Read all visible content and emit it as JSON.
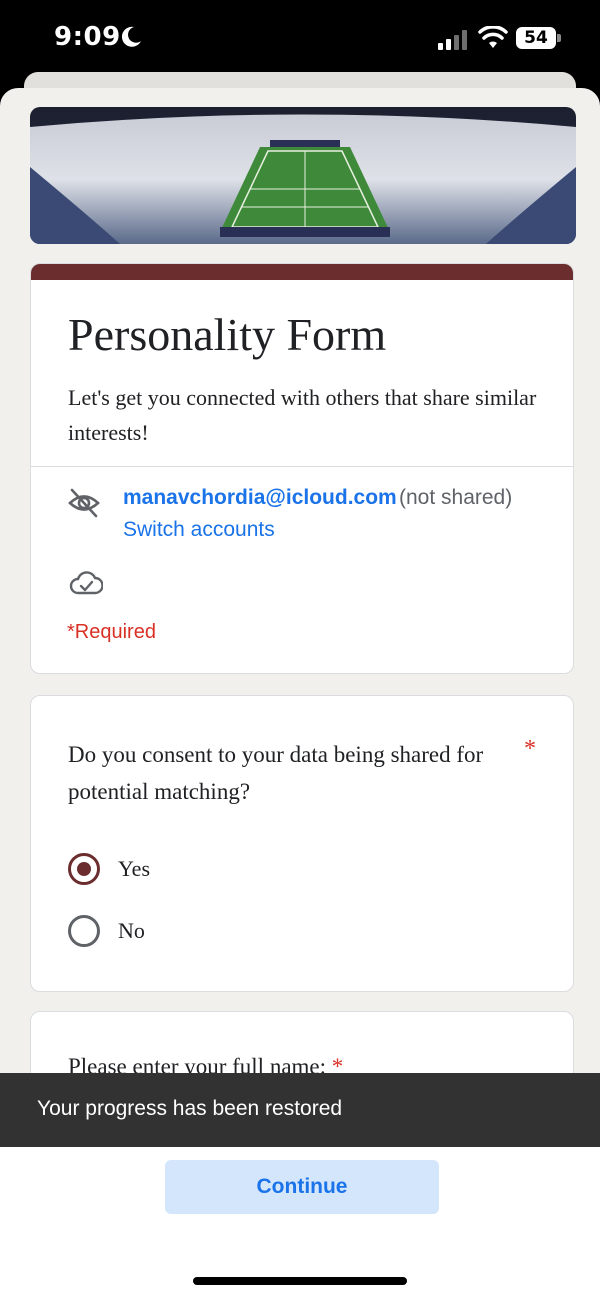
{
  "status_bar": {
    "time": "9:09",
    "battery": "54"
  },
  "form": {
    "title": "Personality Form",
    "description": "Let's get you connected with others that share similar interests!",
    "account_email": "manavchordia@icloud.com",
    "account_note": "(not shared)",
    "switch_accounts": "Switch accounts",
    "required_note": "*Required",
    "accent_color": "#6b2d2d"
  },
  "question_consent": {
    "text": "Do you consent to your data being shared for potential matching?",
    "required_mark": "*",
    "options": [
      {
        "label": "Yes",
        "selected": true
      },
      {
        "label": "No",
        "selected": false
      }
    ]
  },
  "question_name": {
    "text": "Please enter your full name:",
    "required_mark": "*"
  },
  "toast": {
    "message": "Your progress has been restored"
  },
  "continue_button": {
    "label": "Continue"
  },
  "icons": {
    "hidden": "eye-off-icon",
    "saved": "cloud-check-icon"
  }
}
